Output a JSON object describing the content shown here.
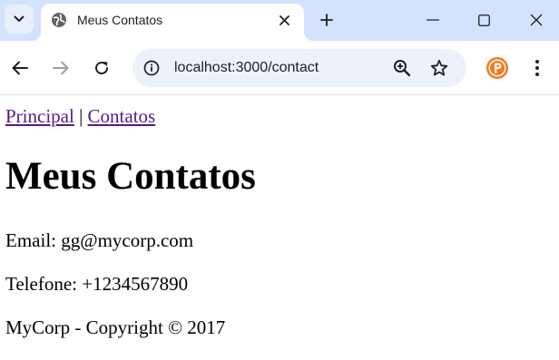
{
  "browser": {
    "tab": {
      "title": "Meus Contatos"
    },
    "address_bar": {
      "url": "localhost:3000/contact"
    }
  },
  "page": {
    "nav": {
      "home_link": "Principal",
      "separator": "|",
      "contacts_link": "Contatos"
    },
    "heading": "Meus Contatos",
    "email_line": "Email: gg@mycorp.com",
    "phone_line": "Telefone: +1234567890",
    "footer_line": "MyCorp - Copyright © 2017"
  },
  "icons": {
    "tab_search": "chevron-down-icon",
    "favicon": "globe-icon",
    "tab_close": "close-icon",
    "new_tab": "plus-icon",
    "back": "arrow-left-icon",
    "forward": "arrow-right-icon",
    "reload": "reload-icon",
    "site_info": "info-icon",
    "zoom": "zoom-in-icon",
    "bookmark": "star-icon",
    "extension": "extension-icon",
    "menu": "kebab-menu-icon"
  },
  "colors": {
    "tabstrip_bg": "#d3e3fd",
    "omnibox_bg": "#edf2fa",
    "visited_link": "#551a8b",
    "extension_orange": "#f47a20"
  }
}
